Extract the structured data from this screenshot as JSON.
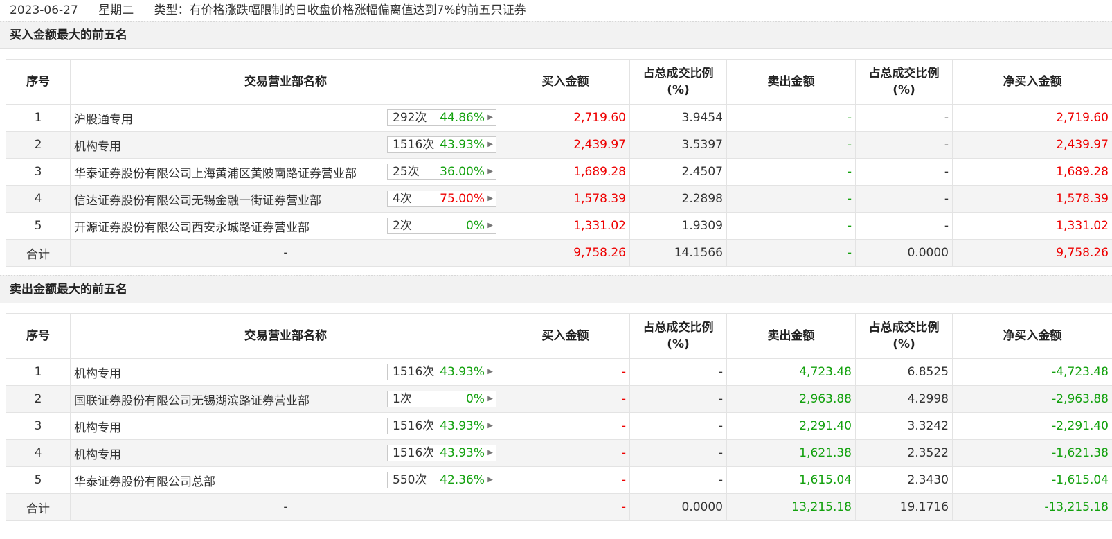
{
  "header": {
    "date": "2023-06-27",
    "weekday": "星期二",
    "type_text": "类型：有价格涨跌幅限制的日收盘价格涨幅偏离值达到7%的前五只证券"
  },
  "columns": [
    "序号",
    "交易营业部名称",
    "买入金额",
    "占总成交比例(%)",
    "卖出金额",
    "占总成交比例(%)",
    "净买入金额"
  ],
  "buy_section": {
    "title": "买入金额最大的前五名",
    "rows": [
      {
        "idx": "1",
        "name": "沪股通专用",
        "times": "292次",
        "rate": "44.86%",
        "rate_color": "green",
        "buy": "2,719.60",
        "buy_pct": "3.9454",
        "sell": "-",
        "sell_pct": "-",
        "net": "2,719.60"
      },
      {
        "idx": "2",
        "name": "机构专用",
        "times": "1516次",
        "rate": "43.93%",
        "rate_color": "green",
        "buy": "2,439.97",
        "buy_pct": "3.5397",
        "sell": "-",
        "sell_pct": "-",
        "net": "2,439.97"
      },
      {
        "idx": "3",
        "name": "华泰证券股份有限公司上海黄浦区黄陂南路证券营业部",
        "times": "25次",
        "rate": "36.00%",
        "rate_color": "green",
        "buy": "1,689.28",
        "buy_pct": "2.4507",
        "sell": "-",
        "sell_pct": "-",
        "net": "1,689.28"
      },
      {
        "idx": "4",
        "name": "信达证券股份有限公司无锡金融一街证券营业部",
        "times": "4次",
        "rate": "75.00%",
        "rate_color": "red",
        "buy": "1,578.39",
        "buy_pct": "2.2898",
        "sell": "-",
        "sell_pct": "-",
        "net": "1,578.39"
      },
      {
        "idx": "5",
        "name": "开源证券股份有限公司西安永城路证券营业部",
        "times": "2次",
        "rate": "0%",
        "rate_color": "green",
        "buy": "1,331.02",
        "buy_pct": "1.9309",
        "sell": "-",
        "sell_pct": "-",
        "net": "1,331.02"
      }
    ],
    "total": {
      "label": "合计",
      "name": "-",
      "buy": "9,758.26",
      "buy_pct": "14.1566",
      "sell": "-",
      "sell_pct": "0.0000",
      "net": "9,758.26"
    }
  },
  "sell_section": {
    "title": "卖出金额最大的前五名",
    "rows": [
      {
        "idx": "1",
        "name": "机构专用",
        "times": "1516次",
        "rate": "43.93%",
        "rate_color": "green",
        "buy": "-",
        "buy_pct": "-",
        "sell": "4,723.48",
        "sell_pct": "6.8525",
        "net": "-4,723.48"
      },
      {
        "idx": "2",
        "name": "国联证券股份有限公司无锡湖滨路证券营业部",
        "times": "1次",
        "rate": "0%",
        "rate_color": "green",
        "buy": "-",
        "buy_pct": "-",
        "sell": "2,963.88",
        "sell_pct": "4.2998",
        "net": "-2,963.88"
      },
      {
        "idx": "3",
        "name": "机构专用",
        "times": "1516次",
        "rate": "43.93%",
        "rate_color": "green",
        "buy": "-",
        "buy_pct": "-",
        "sell": "2,291.40",
        "sell_pct": "3.3242",
        "net": "-2,291.40"
      },
      {
        "idx": "4",
        "name": "机构专用",
        "times": "1516次",
        "rate": "43.93%",
        "rate_color": "green",
        "buy": "-",
        "buy_pct": "-",
        "sell": "1,621.38",
        "sell_pct": "2.3522",
        "net": "-1,621.38"
      },
      {
        "idx": "5",
        "name": "华泰证券股份有限公司总部",
        "times": "550次",
        "rate": "42.36%",
        "rate_color": "green",
        "buy": "-",
        "buy_pct": "-",
        "sell": "1,615.04",
        "sell_pct": "2.3430",
        "net": "-1,615.04"
      }
    ],
    "total": {
      "label": "合计",
      "name": "-",
      "buy": "-",
      "buy_pct": "0.0000",
      "sell": "13,215.18",
      "sell_pct": "19.1716",
      "net": "-13,215.18"
    }
  }
}
